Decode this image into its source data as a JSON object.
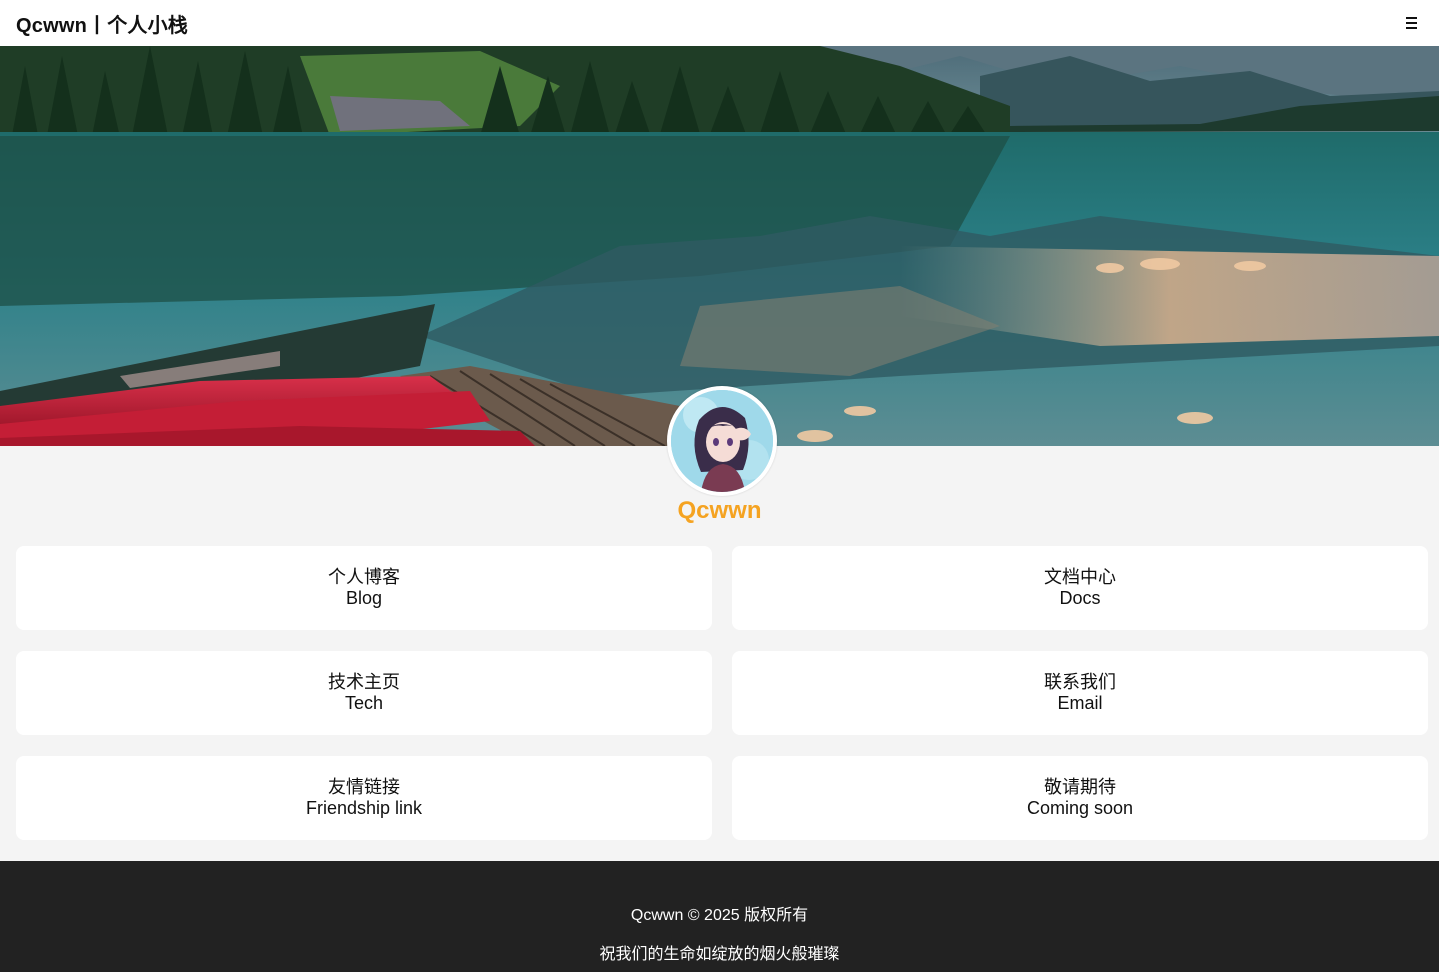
{
  "header": {
    "title": "Qcwwn丨个人小栈",
    "menu_icon": "hamburger-menu-icon"
  },
  "hero": {
    "image": "mountain-lake-with-red-canoes"
  },
  "profile": {
    "avatar": "anime-girl-avatar",
    "name": "Qcwwn"
  },
  "cards": [
    {
      "zh": "个人博客",
      "en": "Blog"
    },
    {
      "zh": "文档中心",
      "en": "Docs"
    },
    {
      "zh": "技术主页",
      "en": "Tech"
    },
    {
      "zh": "联系我们",
      "en": "Email"
    },
    {
      "zh": "友情链接",
      "en": "Friendship link"
    },
    {
      "zh": "敬请期待",
      "en": "Coming soon"
    }
  ],
  "footer": {
    "copyright": "Qcwwn © 2025 版权所有",
    "motto": "祝我们的生命如绽放的烟火般璀璨"
  },
  "colors": {
    "accent": "#f5a321",
    "footer_bg": "#222222",
    "page_bg": "#f4f4f4"
  }
}
